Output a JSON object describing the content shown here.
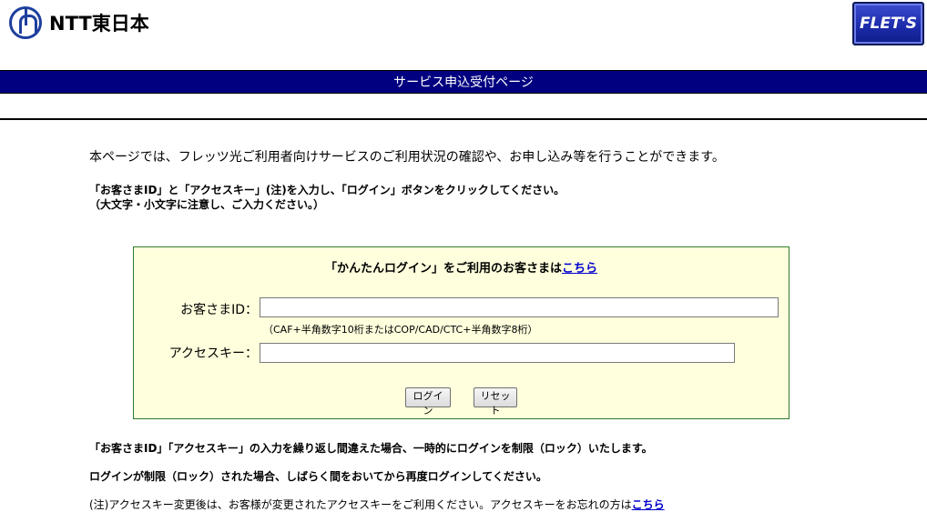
{
  "header": {
    "logo_text": "NTT東日本",
    "badge": "FLET'S"
  },
  "title_bar": "サービス申込受付ページ",
  "intro": "本ページでは、フレッツ光ご利用者向けサービスのご利用状況の確認や、お申し込み等を行うことができます。",
  "instructions": {
    "line1": "「お客さまID」と「アクセスキー」(注)を入力し、「ログイン」ボタンをクリックしてください。",
    "line2": "（大文字・小文字に注意し、ご入力ください。）"
  },
  "login": {
    "easy_text": "「かんたんログイン」をご利用のお客さまは",
    "easy_link": "こちら",
    "id_label": "お客さまID：",
    "id_value": "",
    "id_hint": "（CAF+半角数字10桁またはCOP/CAD/CTC+半角数字8桁）",
    "key_label": "アクセスキー：",
    "key_value": "",
    "login_button": "ログイン",
    "reset_button": "リセット"
  },
  "notices": {
    "line1": "「お客さまID」「アクセスキー」の入力を繰り返し間違えた場合、一時的にログインを制限（ロック）いたします。",
    "line2": "ログインが制限（ロック）された場合、しばらく間をおいてから再度ログインしてください。",
    "line3": "(注)アクセスキー変更後は、お客様が変更されたアクセスキーをご利用ください。アクセスキーをお忘れの方は",
    "line3_link": "こちら"
  }
}
